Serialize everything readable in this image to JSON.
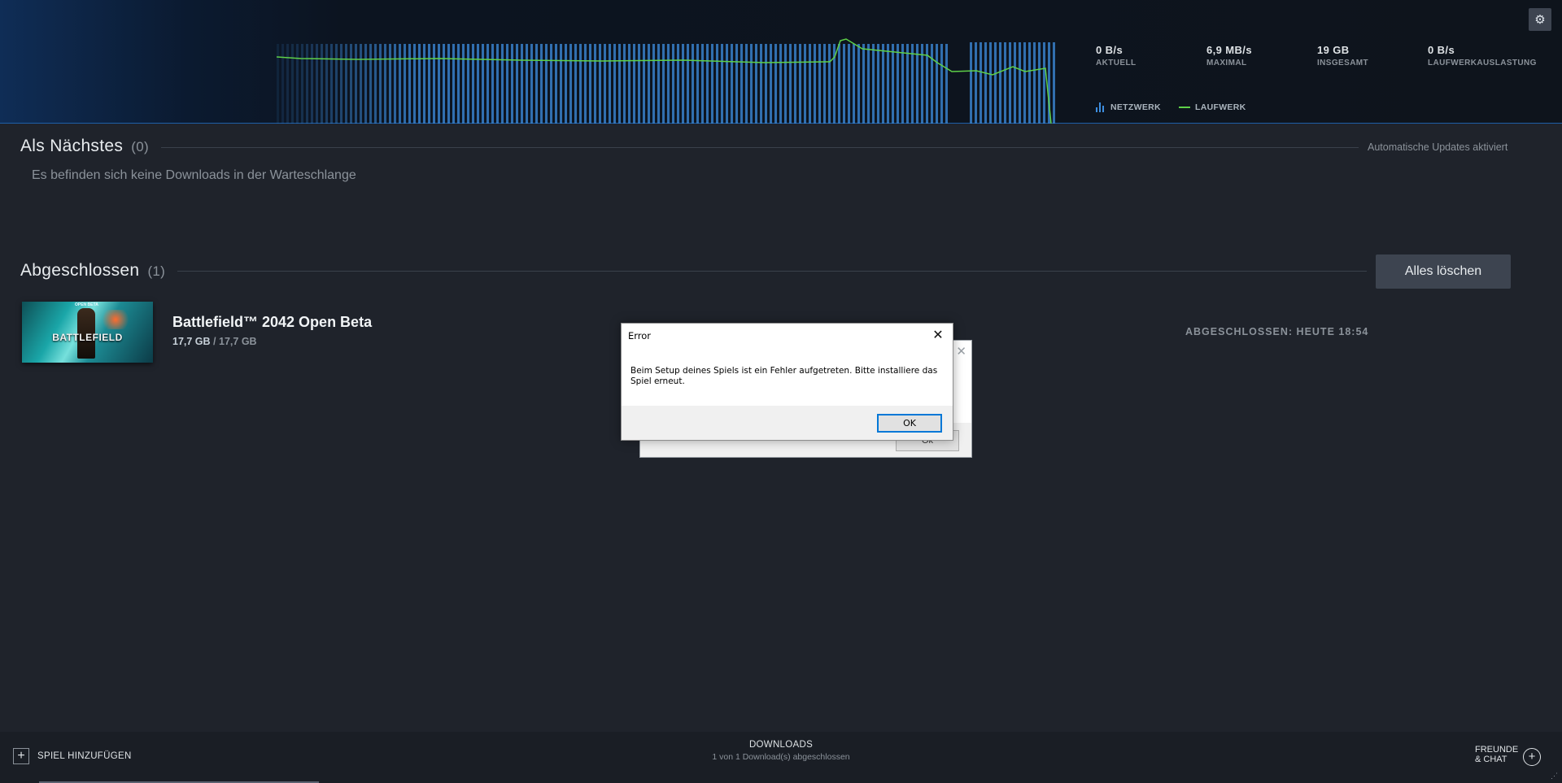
{
  "header": {
    "stats": [
      {
        "value": "0 B/s",
        "label": "AKTUELL"
      },
      {
        "value": "6,9 MB/s",
        "label": "MAXIMAL"
      },
      {
        "value": "19 GB",
        "label": "INSGESAMT"
      },
      {
        "value": "0 B/s",
        "label": "LAUFWERKAUSLASTUNG"
      }
    ],
    "legend": {
      "network": "NETZWERK",
      "disk": "LAUFWERK"
    },
    "colors": {
      "network": "#3d8ee0",
      "disk": "#5ed048"
    },
    "settings_icon": "gear-icon"
  },
  "queue": {
    "title": "Als Nächstes",
    "count": "(0)",
    "auto_updates": "Automatische Updates aktiviert",
    "empty_message": "Es befinden sich keine Downloads in der Warteschlange"
  },
  "completed": {
    "title": "Abgeschlossen",
    "count": "(1)",
    "clear_all": "Alles löschen",
    "items": [
      {
        "thumb_tag": "OPEN BETA",
        "thumb_logo": "BATTLEFIELD",
        "name": "Battlefield™ 2042 Open Beta",
        "size_done": "17,7 GB",
        "size_separator": "/",
        "size_total": "17,7 GB",
        "finished": "ABGESCHLOSSEN: HEUTE 18:54"
      }
    ]
  },
  "dialog": {
    "title": "Error",
    "message": "Beim Setup deines Spiels ist ein Fehler aufgetreten. Bitte installiere das Spiel erneut.",
    "ok": "OK",
    "close_icon": "close-icon",
    "back_ok": "Ok"
  },
  "footer": {
    "add_game": "SPIEL HINZUFÜGEN",
    "downloads": "DOWNLOADS",
    "downloads_status": "1 von 1 Download(s) abgeschlossen",
    "friends_line1": "FREUNDE",
    "friends_line2": "& CHAT"
  }
}
